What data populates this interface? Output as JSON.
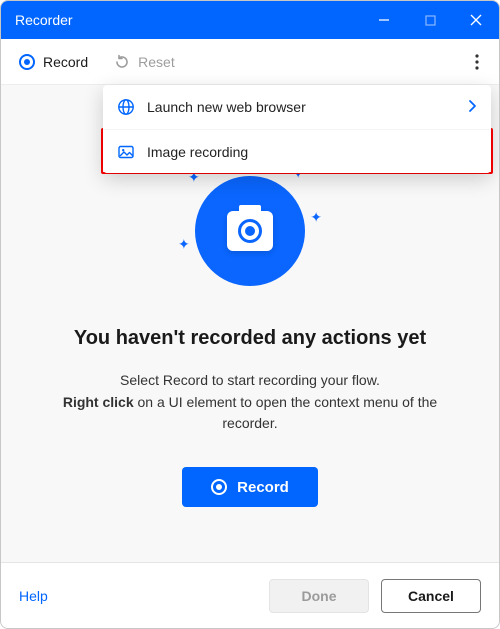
{
  "window": {
    "title": "Recorder"
  },
  "toolbar": {
    "record_label": "Record",
    "reset_label": "Reset"
  },
  "dropdown": {
    "launch_label": "Launch new web browser",
    "image_recording_label": "Image recording",
    "image_recording_on": true
  },
  "empty_state": {
    "headline": "You haven't recorded any actions yet",
    "line1": "Select Record to start recording your flow.",
    "bold_prefix": "Right click",
    "line2_rest": " on a UI element to open the context menu of the recorder.",
    "record_button": "Record"
  },
  "footer": {
    "help": "Help",
    "done": "Done",
    "cancel": "Cancel"
  }
}
